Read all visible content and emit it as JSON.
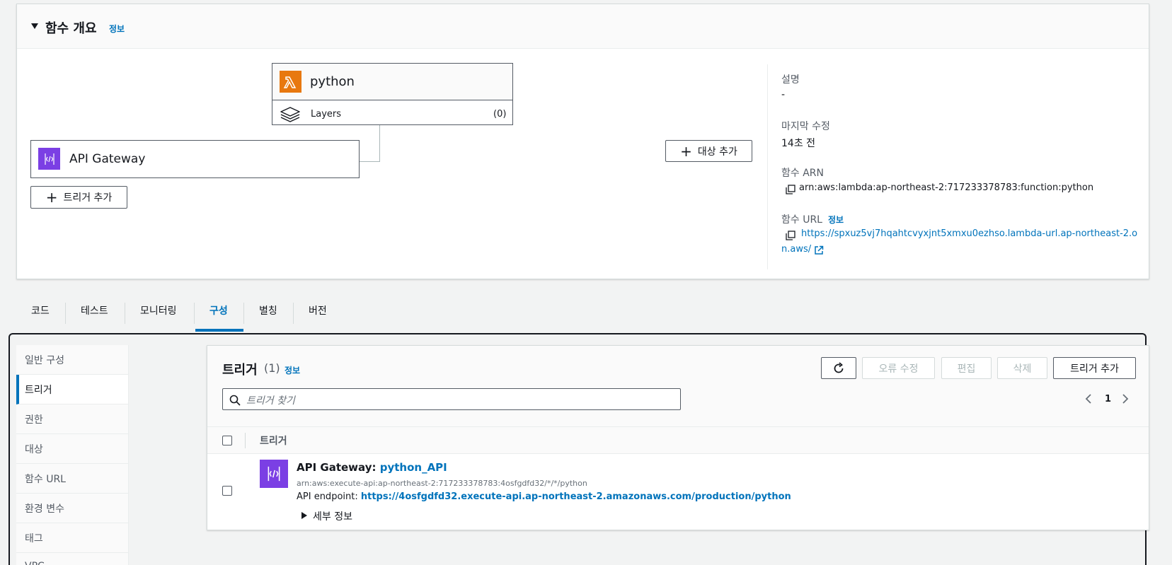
{
  "overview": {
    "title": "함수 개요",
    "info": "정보",
    "function_name": "python",
    "layers_label": "Layers",
    "layers_count": "(0)",
    "trigger_name": "API Gateway",
    "add_trigger": "트리거 추가",
    "add_destination": "대상 추가"
  },
  "details": {
    "description_label": "설명",
    "description_value": "-",
    "modified_label": "마지막 수정",
    "modified_value": "14초 전",
    "arn_label": "함수 ARN",
    "arn_value": "arn:aws:lambda:ap-northeast-2:717233378783:function:python",
    "url_label": "함수 URL",
    "url_info": "정보",
    "url_value_line1": "https://spxuz5vj7hqahtcvyxjnt5xmxu0ezhso.lambda-url.ap-northeast-2.o",
    "url_value_line2": "n.aws/"
  },
  "tabs": [
    "코드",
    "테스트",
    "모니터링",
    "구성",
    "별칭",
    "버전"
  ],
  "active_tab": "구성",
  "sidebar": {
    "items": [
      "일반 구성",
      "트리거",
      "권한",
      "대상",
      "함수 URL",
      "환경 변수",
      "태그",
      "VPC"
    ],
    "active": "트리거"
  },
  "triggers": {
    "title": "트리거",
    "count": "(1)",
    "info": "정보",
    "buttons": {
      "refresh": "refresh",
      "fix_errors": "오류 수정",
      "edit": "편집",
      "delete": "삭제",
      "add": "트리거 추가"
    },
    "search_placeholder": "트리거 찾기",
    "page": "1",
    "column_header": "트리거",
    "rows": [
      {
        "service": "API Gateway",
        "separator": ":",
        "api_name": "python_API",
        "arn": "arn:aws:execute-api:ap-northeast-2:717233378783:4osfgdfd32/*/*/python",
        "endpoint_label": "API endpoint:",
        "endpoint_url": "https://4osfgdfd32.execute-api.ap-northeast-2.amazonaws.com/production/python",
        "details_label": "세부 정보"
      }
    ]
  },
  "colors": {
    "accent": "#0073bb",
    "lambda": "#e8780f",
    "apigw": "#7b3fe4"
  }
}
